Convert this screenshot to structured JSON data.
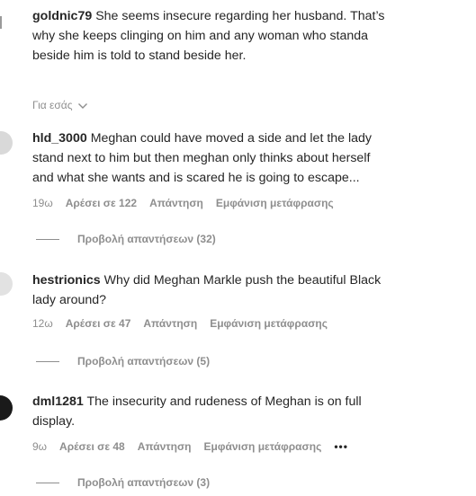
{
  "comments": [
    {
      "username": "goldnic79",
      "lines": [
        "She seems insecure regarding her husband. That’s",
        "why she keeps clinging on him and any woman who standa",
        "beside him is told to stand beside her."
      ]
    },
    {
      "username": "hld_3000",
      "lines": [
        "Meghan could have moved a side and let the lady",
        "stand next to him but then meghan only thinks about herself",
        "and what she wants and is scared he is going to escape..."
      ],
      "time": "19ω",
      "likes": "Αρέσει σε 122",
      "reply": "Απάντηση",
      "translate": "Εμφάνιση μετάφρασης",
      "view_replies": "Προβολή απαντήσεων (32)"
    },
    {
      "username": "hestrionics",
      "lines": [
        "Why did Meghan Markle push the beautiful Black",
        "lady around?"
      ],
      "time": "12ω",
      "likes": "Αρέσει σε 47",
      "reply": "Απάντηση",
      "translate": "Εμφάνιση μετάφρασης",
      "view_replies": "Προβολή απαντήσεων (5)"
    },
    {
      "username": "dml1281",
      "lines": [
        "The insecurity and rudeness of Meghan is on full",
        "display."
      ],
      "time": "9ω",
      "likes": "Αρέσει σε 48",
      "reply": "Απάντηση",
      "translate": "Εμφάνιση μετάφρασης",
      "more": "•••",
      "view_replies": "Προβολή απαντήσεων (3)"
    }
  ],
  "section_label": "Για εσάς",
  "icons": {
    "like": "heart-outline-icon",
    "chevron": "chevron-down-icon",
    "more": "more-options-icon"
  },
  "colors": {
    "text": "#262626",
    "secondary": "#8e8e8e"
  }
}
